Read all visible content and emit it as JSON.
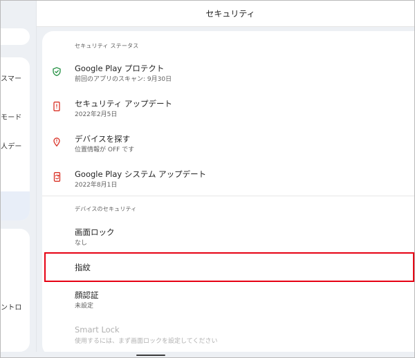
{
  "header": {
    "title": "セキュリティ"
  },
  "left_pane": {
    "labels": [
      "スマー",
      "モード",
      "人デー",
      "ントロ"
    ]
  },
  "security_status": {
    "section_label": "セキュリティ ステータス",
    "items": [
      {
        "title": "Google Play プロテクト",
        "subtitle": "前回のアプリのスキャン: 9月30日",
        "icon": "shield-check-icon",
        "color": "#1e8e3e"
      },
      {
        "title": "セキュリティ アップデート",
        "subtitle": "2022年2月5日",
        "icon": "phone-alert-icon",
        "color": "#d93025"
      },
      {
        "title": "デバイスを探す",
        "subtitle": "位置情報が OFF です",
        "icon": "location-pin-icon",
        "color": "#d93025"
      },
      {
        "title": "Google Play システム アップデート",
        "subtitle": "2022年8月1日",
        "icon": "phone-sync-icon",
        "color": "#d93025"
      }
    ]
  },
  "device_security": {
    "section_label": "デバイスのセキュリティ",
    "items": [
      {
        "title": "画面ロック",
        "subtitle": "なし"
      },
      {
        "title": "指紋",
        "subtitle": ""
      },
      {
        "title": "顔認証",
        "subtitle": "未設定"
      },
      {
        "title": "Smart Lock",
        "subtitle": "使用するには、まず画面ロックを設定してください"
      }
    ]
  },
  "colors": {
    "highlight_border": "#e60012",
    "status_ok": "#1e8e3e",
    "status_warn": "#d93025"
  }
}
